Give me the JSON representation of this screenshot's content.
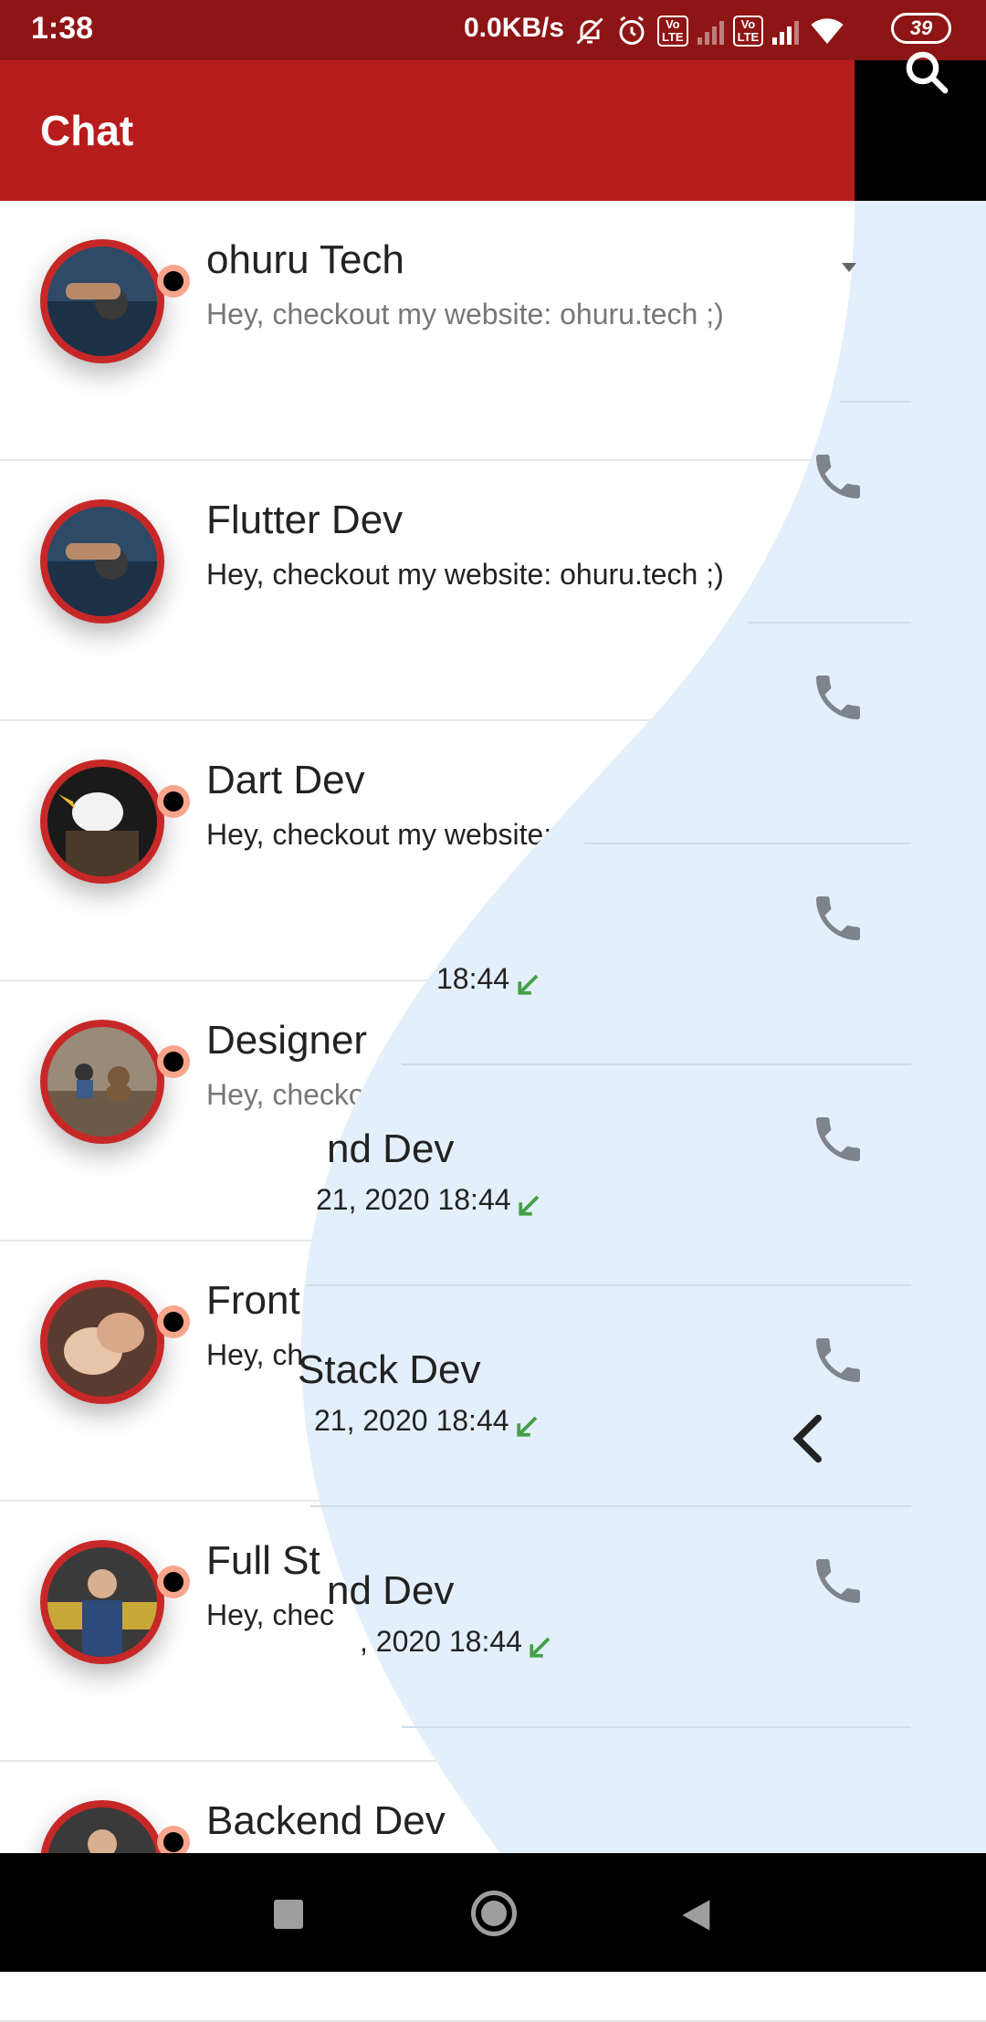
{
  "status_bar": {
    "time": "1:38",
    "network_speed": "0.0KB/s",
    "volte_label": "Vo LTE",
    "battery": "39"
  },
  "app_bar": {
    "title": "Chat"
  },
  "chats": [
    {
      "name": "ohuru Tech",
      "message": "Hey, checkout my website: ohuru.tech ;)",
      "muted": true
    },
    {
      "name": "Flutter Dev",
      "message": "Hey, checkout my website: ohuru.tech ;)",
      "muted": false
    },
    {
      "name": "Dart Dev",
      "message": "Hey, checkout my website:",
      "muted": false
    },
    {
      "name": "Designer",
      "message": "Hey, checko",
      "muted": true
    },
    {
      "name": "Front",
      "message": "Hey, ch",
      "muted": false
    },
    {
      "name": "Full St",
      "message": "Hey, chec",
      "muted": false
    },
    {
      "name": "Backend Dev",
      "message": "",
      "muted": false
    }
  ],
  "call_log": [
    {
      "name": "",
      "time": "18:44"
    },
    {
      "name": "nd Dev",
      "time": "21, 2020 18:44"
    },
    {
      "name": "Stack Dev",
      "time": "21, 2020 18:44"
    },
    {
      "name": "nd Dev",
      "time": ", 2020 18:44"
    }
  ],
  "colors": {
    "primary": "#b71c1c",
    "status_bar": "#8e1515",
    "curtain": "#e3effb",
    "tick": "#43a047"
  }
}
